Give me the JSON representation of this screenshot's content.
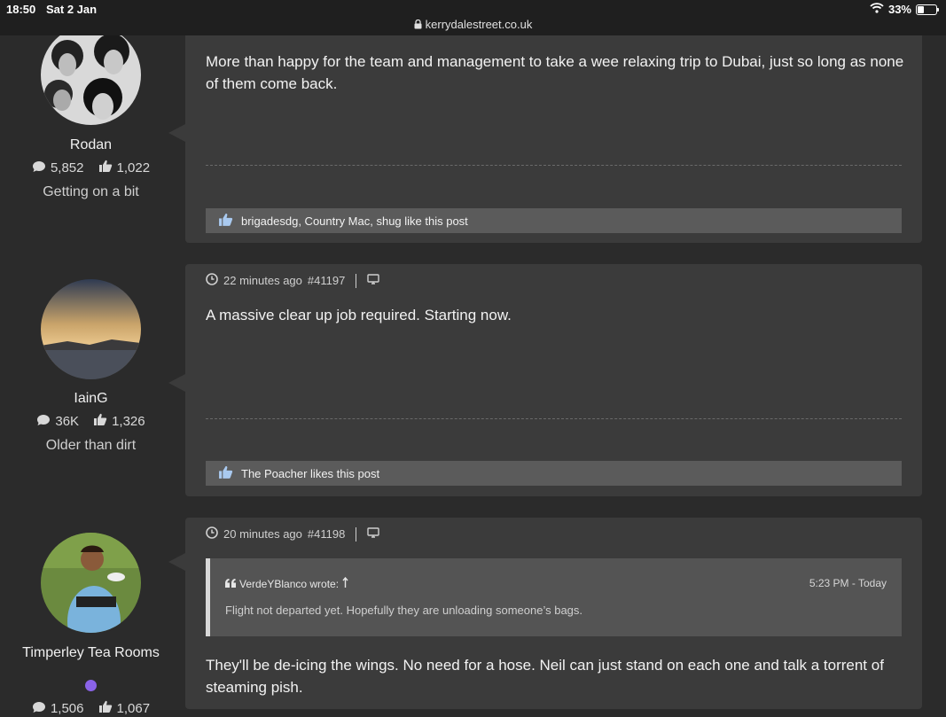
{
  "status_bar": {
    "time": "18:50",
    "date": "Sat 2 Jan",
    "url": "kerrydalestreet.co.uk",
    "battery": "33%",
    "battery_level": 0.33
  },
  "posts": [
    {
      "author": {
        "name": "Rodan",
        "messages": "5,852",
        "reactions": "1,022",
        "rank": "Getting on a bit"
      },
      "body": "More than happy for the team and management to take a wee relaxing trip to Dubai, just so long as none of them come back.",
      "likes": "brigadesdg, Country Mac, shug like this post"
    },
    {
      "author": {
        "name": "IainG",
        "messages": "36K",
        "reactions": "1,326",
        "rank": "Older than dirt"
      },
      "time": "22 minutes ago",
      "post_number": "#41197",
      "body": "A massive clear up job required. Starting now.",
      "likes": "The Poacher likes this post"
    },
    {
      "author": {
        "name": "Timperley Tea Rooms",
        "messages": "1,506",
        "reactions": "1,067"
      },
      "time": "20 minutes ago",
      "post_number": "#41198",
      "quote": {
        "author": "VerdeYBlanco wrote:",
        "time": "5:23 PM - Today",
        "text": "Flight not departed yet. Hopefully they are unloading someone’s bags."
      },
      "body": "They'll be de-icing the wings. No need for a hose. Neil can just stand on each one and talk a torrent of steaming pish."
    }
  ],
  "colors": {
    "page_bg": "#2b2b2b",
    "card_bg": "#3b3b3b",
    "likes_bar": "#5b5b5b",
    "online": "#8a63e8"
  }
}
